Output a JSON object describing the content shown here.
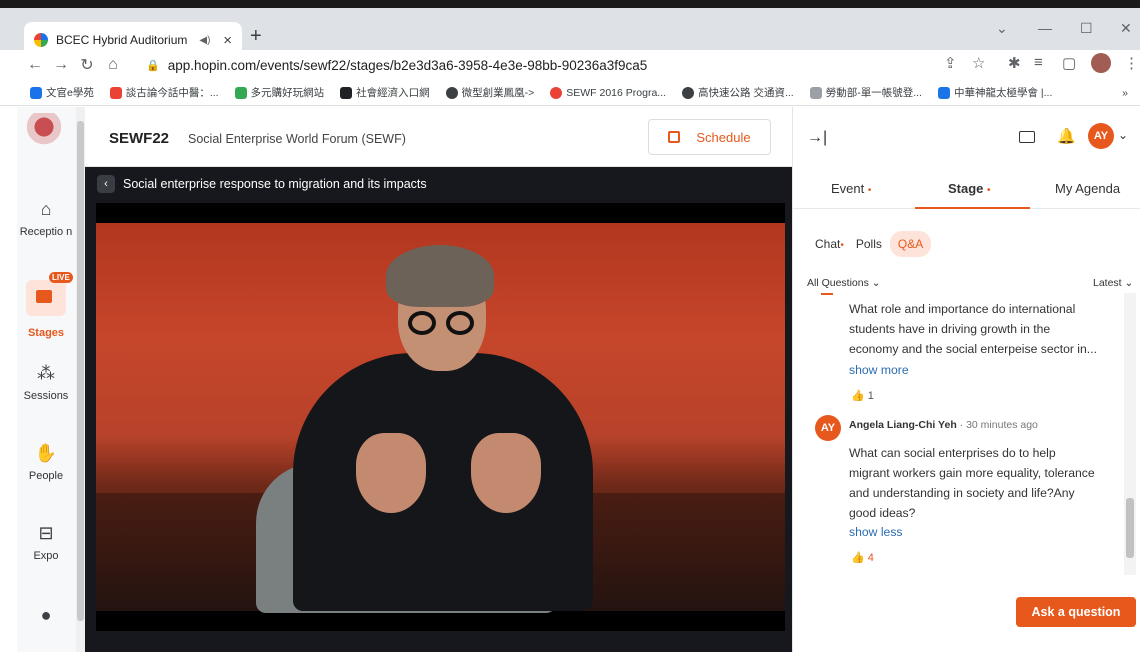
{
  "browser": {
    "tab_title": "BCEC Hybrid Auditorium",
    "tab_audio_icon": "◀)",
    "tab_close": "×",
    "new_tab": "+",
    "url": "app.hopin.com/events/sewf22/stages/b2e3d3a6-3958-4e3e-98bb-90236a3f9ca5",
    "window_controls": [
      "⌄",
      "—",
      "☐",
      "✕"
    ],
    "bookmarks": [
      {
        "label": "文官e學苑",
        "icon_color": "#1a73e8"
      },
      {
        "label": "談古論今話中醫：...",
        "icon_color": "#ea4335"
      },
      {
        "label": "多元購好玩網站",
        "icon_color": "#34a853"
      },
      {
        "label": "社會經濟入口網",
        "icon_color": "#202124"
      },
      {
        "label": "微型創業鳳凰->",
        "icon_color": "#3c4043"
      },
      {
        "label": "SEWF 2016 Progra...",
        "icon_color": "#ea4335"
      },
      {
        "label": "高快速公路 交通資...",
        "icon_color": "#3c4043"
      },
      {
        "label": "勞動部-單一帳號登...",
        "icon_color": "#9aa0a6"
      },
      {
        "label": "中華神龍太極學會 |...",
        "icon_color": "#1a73e8"
      }
    ],
    "more_bookmarks": "»"
  },
  "sidebar": {
    "items": [
      {
        "label": "Receptio n",
        "icon": "home-icon"
      },
      {
        "label": "Stages",
        "icon": "video-camera-icon",
        "badge": "LIVE"
      },
      {
        "label": "Sessions",
        "icon": "people-group-icon"
      },
      {
        "label": "People",
        "icon": "handshake-icon"
      },
      {
        "label": "Expo",
        "icon": "booth-icon"
      }
    ]
  },
  "header": {
    "event_short": "SEWF22",
    "event_full": "Social Enterprise World Forum (SEWF)",
    "schedule_label": "Schedule"
  },
  "stage": {
    "title": "Social enterprise response to migration and its impacts"
  },
  "right_panel": {
    "avatar_initials": "AY",
    "tabs": [
      {
        "label": "Event",
        "has_dot": true
      },
      {
        "label": "Stage",
        "has_dot": true
      },
      {
        "label": "My Agenda",
        "has_dot": false
      }
    ],
    "subtabs": [
      {
        "label": "Chat",
        "has_dot": true
      },
      {
        "label": "Polls",
        "has_dot": false
      },
      {
        "label": "Q&A",
        "active": true
      }
    ],
    "filter_left": "All Questions ⌄",
    "filter_right": "Latest ⌄",
    "questions": [
      {
        "lines": [
          "What role and importance do international",
          "students have in driving growth in the",
          "economy and the social enterpeise sector in..."
        ],
        "toggle": "show more",
        "likes": "1"
      },
      {
        "author_initials": "AY",
        "author": "Angela Liang-Chi Yeh",
        "time": "· 30 minutes ago",
        "lines": [
          "What can social enterprises do to help",
          "migrant workers gain more equality, tolerance",
          "and understanding in society and life?Any",
          "good ideas?"
        ],
        "toggle": "show less",
        "likes": "4"
      }
    ],
    "ask_button": "Ask a question"
  },
  "colors": {
    "accent": "#e6581c",
    "link": "#2b6cb0",
    "stage_bg": "#16181d"
  }
}
